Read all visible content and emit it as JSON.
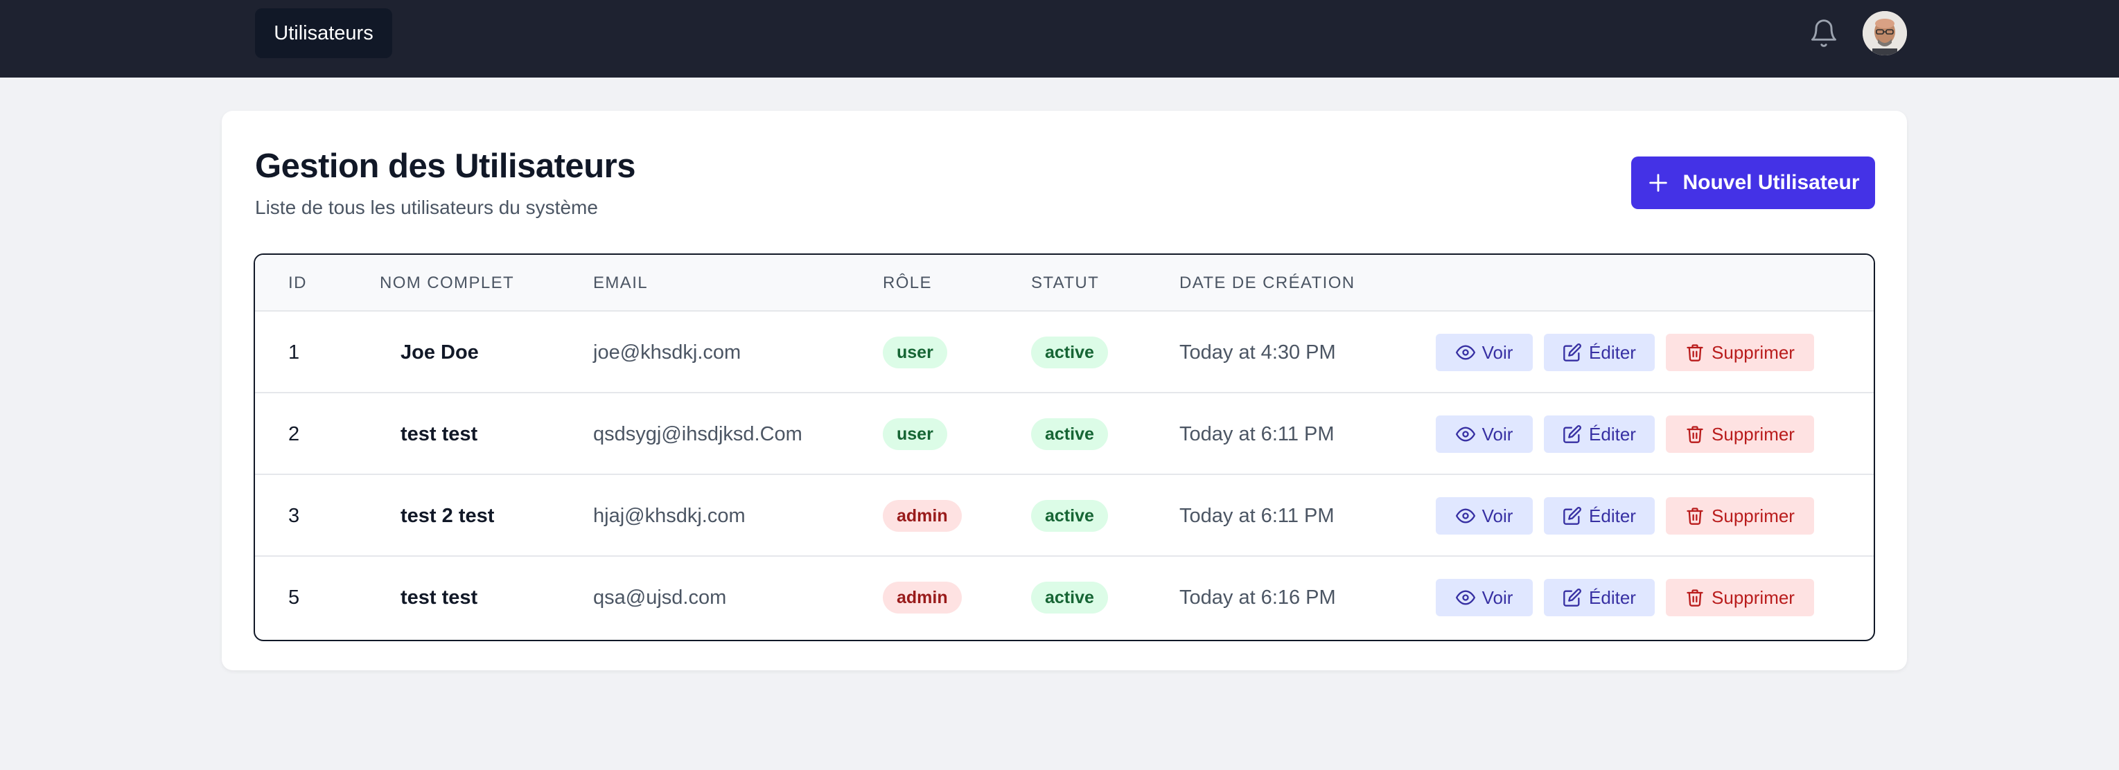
{
  "navbar": {
    "tab_label": "Utilisateurs",
    "bell_icon": "bell-icon",
    "avatar_icon": "user-avatar"
  },
  "header": {
    "title": "Gestion des Utilisateurs",
    "subtitle": "Liste de tous les utilisateurs du système",
    "new_button_label": "Nouvel Utilisateur",
    "new_button_icon": "plus-icon"
  },
  "table": {
    "columns": [
      "ID",
      "NOM COMPLET",
      "EMAIL",
      "RÔLE",
      "STATUT",
      "DATE DE CRÉATION"
    ],
    "rows": [
      {
        "id": "1",
        "name": "Joe Doe",
        "email": "joe@khsdkj.com",
        "role": "user",
        "status": "active",
        "date": "Today at 4:30 PM"
      },
      {
        "id": "2",
        "name": "test test",
        "email": "qsdsygj@ihsdjksd.Com",
        "role": "user",
        "status": "active",
        "date": "Today at 6:11 PM"
      },
      {
        "id": "3",
        "name": "test 2 test",
        "email": "hjaj@khsdkj.com",
        "role": "admin",
        "status": "active",
        "date": "Today at 6:11 PM"
      },
      {
        "id": "5",
        "name": "test test",
        "email": "qsa@ujsd.com",
        "role": "admin",
        "status": "active",
        "date": "Today at 6:16 PM"
      }
    ],
    "actions": {
      "view_label": "Voir",
      "edit_label": "Éditer",
      "delete_label": "Supprimer"
    }
  },
  "colors": {
    "navbar_bg": "#1e2230",
    "primary": "#4432e6",
    "badge_green_bg": "#dcfce7",
    "badge_green_text": "#166534",
    "badge_red_bg": "#fee2e2",
    "badge_red_text": "#991b1b",
    "action_blue_bg": "#e0e7ff",
    "action_red_bg": "#fee2e2"
  }
}
